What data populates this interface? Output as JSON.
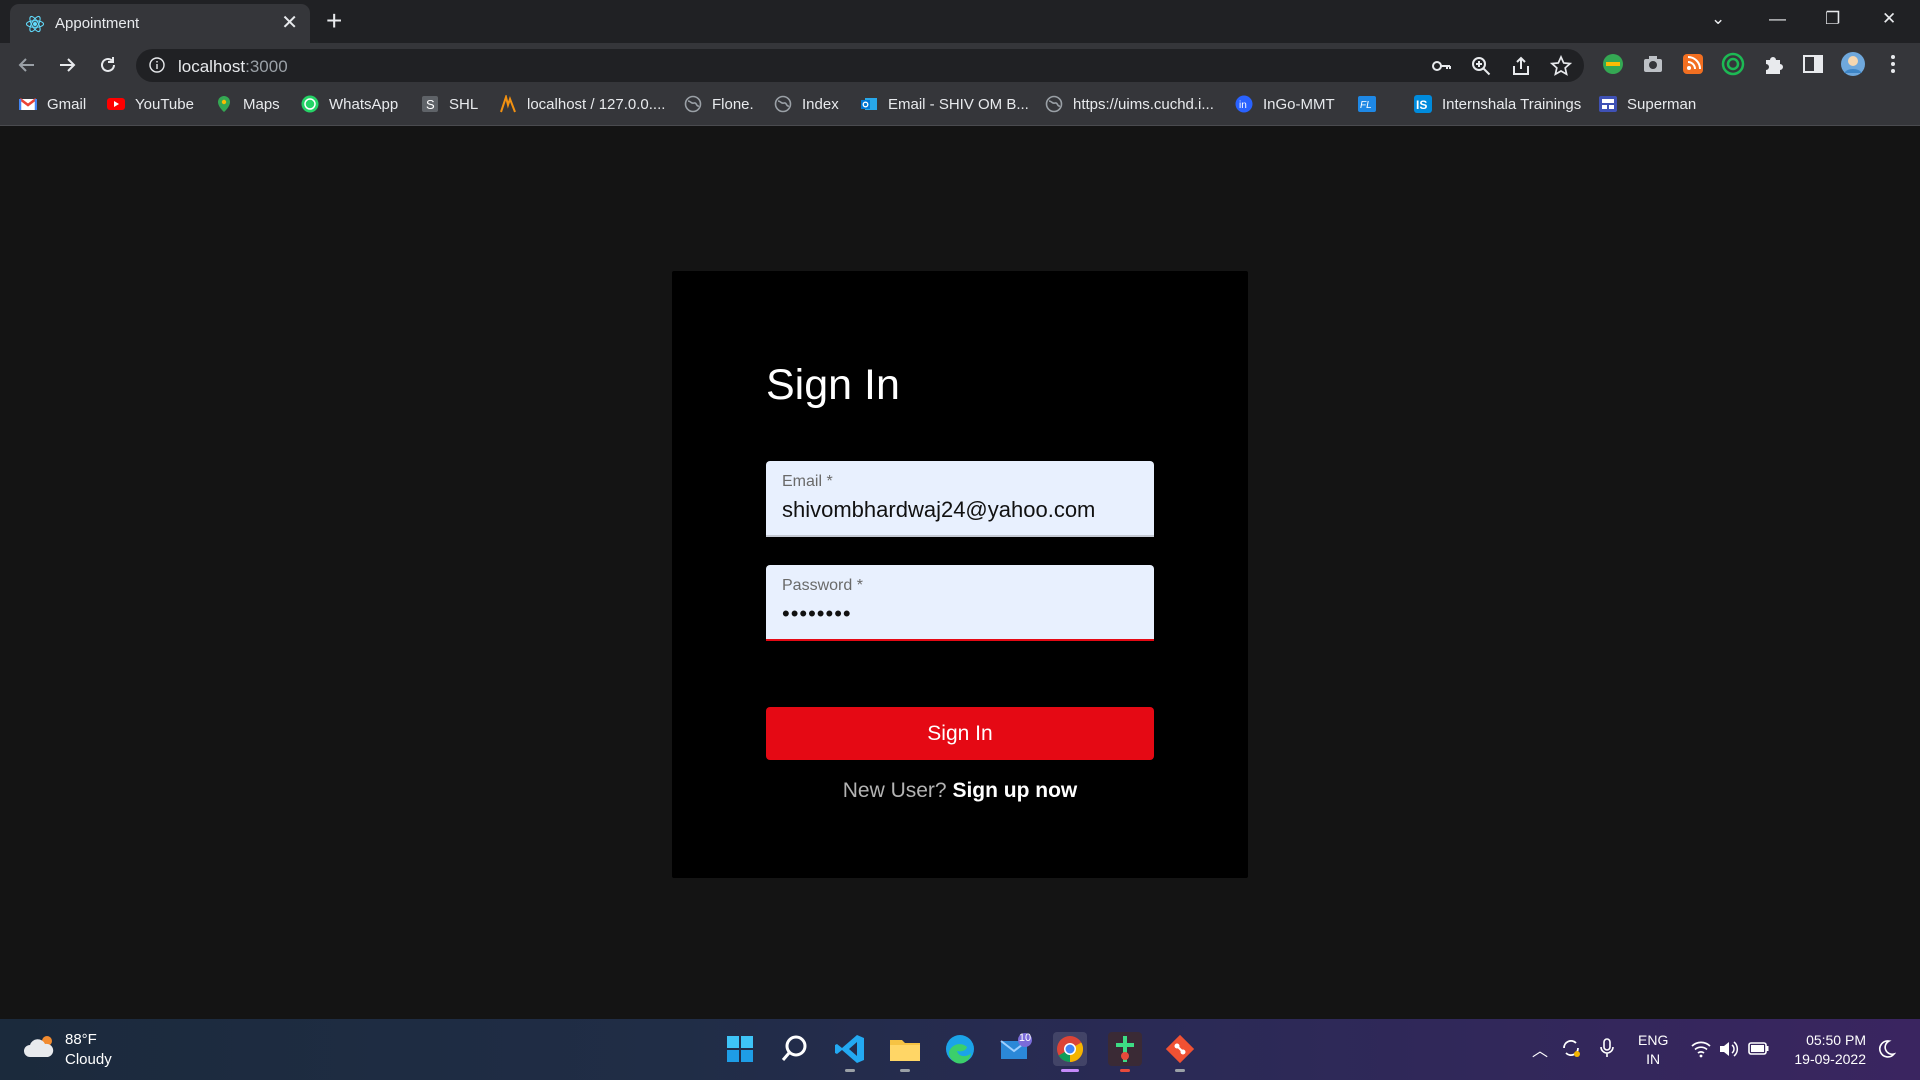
{
  "browser": {
    "tab_title": "Appointment",
    "url_host": "localhost",
    "url_port": ":3000"
  },
  "bookmarks": [
    {
      "label": "Gmail",
      "icon": "gmail-icon",
      "color": "#ea4335"
    },
    {
      "label": "YouTube",
      "icon": "youtube-icon",
      "color": "#ff0000"
    },
    {
      "label": "Maps",
      "icon": "maps-icon",
      "color": "#34a853"
    },
    {
      "label": "WhatsApp",
      "icon": "whatsapp-icon",
      "color": "#25d366"
    },
    {
      "label": "SHL",
      "icon": "shl-icon",
      "color": "#9aa0a6"
    },
    {
      "label": "localhost / 127.0.0....",
      "icon": "phpmyadmin-icon",
      "color": "#f29111"
    },
    {
      "label": "Flone.",
      "icon": "globe-icon",
      "color": "#9aa0a6"
    },
    {
      "label": "Index",
      "icon": "globe-icon",
      "color": "#9aa0a6"
    },
    {
      "label": "Email - SHIV OM B...",
      "icon": "outlook-icon",
      "color": "#0078d4"
    },
    {
      "label": "https://uims.cuchd.i...",
      "icon": "globe-icon",
      "color": "#9aa0a6"
    },
    {
      "label": "InGo-MMT",
      "icon": "ingo-icon",
      "color": "#2962ff"
    },
    {
      "label": "",
      "icon": "fl-icon",
      "color": "#1e88e5"
    },
    {
      "label": "Internshala Trainings",
      "icon": "internshala-icon",
      "color": "#008bdc"
    },
    {
      "label": "Superman",
      "icon": "superman-icon",
      "color": "#3f51b5"
    }
  ],
  "signin": {
    "title": "Sign In",
    "email_label": "Email *",
    "email_value": "shivombhardwaj24@yahoo.com",
    "password_label": "Password *",
    "password_value": "••••••••",
    "button_label": "Sign In",
    "new_user_text": "New User?",
    "signup_link": "Sign up now",
    "accent_color": "#e50914"
  },
  "taskbar": {
    "weather_temp": "88°F",
    "weather_desc": "Cloudy",
    "mail_badge": "10",
    "lang_line1": "ENG",
    "lang_line2": "IN",
    "time": "05:50 PM",
    "date": "19-09-2022"
  }
}
